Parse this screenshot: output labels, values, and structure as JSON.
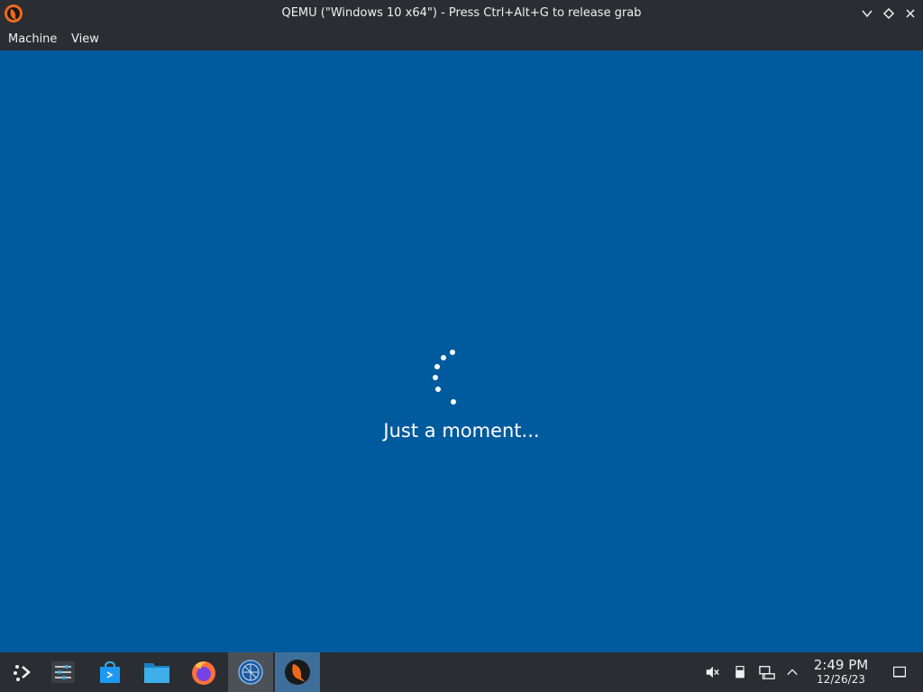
{
  "window": {
    "title": "QEMU (\"Windows 10 x64\") - Press Ctrl+Alt+G to release grab",
    "controls": [
      "minimize",
      "maximize",
      "close"
    ]
  },
  "menubar": {
    "items": [
      {
        "label": "Machine"
      },
      {
        "label": "View"
      }
    ]
  },
  "vm_screen": {
    "background": "#005a9e",
    "message": "Just a moment..."
  },
  "taskbar": {
    "apps": [
      {
        "name": "application-launcher",
        "icon": "kde-launcher-icon"
      },
      {
        "name": "system-settings",
        "icon": "settings-sliders-icon"
      },
      {
        "name": "discover-store",
        "icon": "store-bag-icon"
      },
      {
        "name": "file-manager",
        "icon": "folder-icon"
      },
      {
        "name": "firefox",
        "icon": "firefox-icon"
      },
      {
        "name": "network-browser",
        "icon": "globe-icon"
      },
      {
        "name": "qemu",
        "icon": "qemu-icon"
      }
    ],
    "tray": [
      "volume-muted-icon",
      "usb-drive-icon",
      "network-wired-icon",
      "chevron-up-icon"
    ],
    "clock": {
      "time": "2:49 PM",
      "date": "12/26/23"
    }
  },
  "colors": {
    "panel": "#2a2e32",
    "accent": "#3daee9",
    "vm_blue": "#005a9e"
  }
}
